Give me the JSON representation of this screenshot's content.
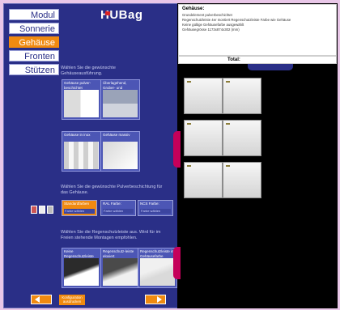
{
  "nav": {
    "tabs": [
      {
        "label": "Modul",
        "active": false
      },
      {
        "label": "Sonnerie",
        "active": false
      },
      {
        "label": "Gehäuse",
        "active": true
      },
      {
        "label": "Fronten",
        "active": false
      },
      {
        "label": "Stützen",
        "active": false
      }
    ]
  },
  "logo": {
    "text": "HUBag"
  },
  "housing": {
    "instruction": "Wählen Sie die gewünschte Gehäuseausführung.",
    "options": [
      {
        "label": "Gehäuse pulver-beschichtet"
      },
      {
        "label": "Überlagehend, Gruber- und Rückseite beidseitig"
      },
      {
        "label": "Gehäuse in inox"
      },
      {
        "label": "Gehäuse massiv"
      }
    ]
  },
  "powder": {
    "instruction": "Wählen Sie die gewünschte Pulverbeschichtung für das Gehäuse.",
    "fields": [
      {
        "title": "Standardfarben",
        "value": "Farbe wählen"
      },
      {
        "title": "RAL Farbe:",
        "value": "Farbe wählen"
      },
      {
        "title": "NCS Farbe:",
        "value": "Farbe wählen"
      }
    ]
  },
  "rain": {
    "instruction": "Wählen Sie die Regenschutzleiste aus. Wird für im Freien stehende Montagen empfohlen.",
    "options": [
      {
        "label": "Keine Regenschutzleiste"
      },
      {
        "label": "Regenschutz-leiste eloxiert"
      },
      {
        "label": "Regenschutzleiste in Gehäusefarbe"
      }
    ]
  },
  "buttons": {
    "prev_label": "",
    "next_label": "",
    "konfig_label": "Konfiguration ausdrucken"
  },
  "summary": {
    "title": "Gehäuse:",
    "lines": [
      "Grundelement pulverbeschichtet",
      "Regenschutzleiste 4er montiert Regenschutzleiste Farbe wie Gehäuse",
      "Keine gültige Gehäusefarbe ausgewählt",
      "Gehäusegrösse 1173x874x302 (mm)"
    ],
    "total_label": "Total:"
  }
}
